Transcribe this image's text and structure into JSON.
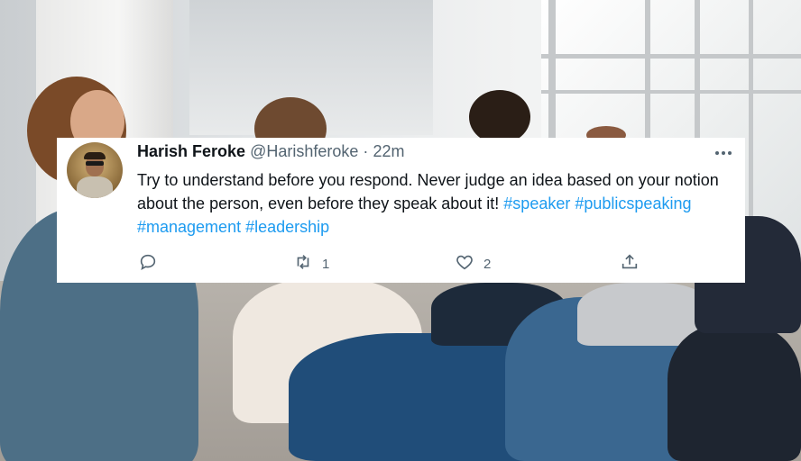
{
  "tweet": {
    "author_name": "Harish Feroke",
    "handle": "@Harishferoke",
    "separator": "·",
    "time": "22m",
    "more_icon": "more-horizontal-icon",
    "body": {
      "text": "Try to understand before you respond.  Never judge an idea based on your notion about the person, even before they speak about it! ",
      "hashtags": [
        "#speaker",
        "#publicspeaking",
        "#management",
        "#leadership"
      ]
    },
    "actions": {
      "reply": {
        "icon": "reply-icon",
        "count": ""
      },
      "retweet": {
        "icon": "retweet-icon",
        "count": "1"
      },
      "like": {
        "icon": "heart-icon",
        "count": "2"
      },
      "share": {
        "icon": "share-icon",
        "count": ""
      }
    }
  },
  "colors": {
    "text": "#0f1419",
    "secondary": "#536471",
    "link": "#1d9bf0",
    "card": "#ffffff"
  }
}
